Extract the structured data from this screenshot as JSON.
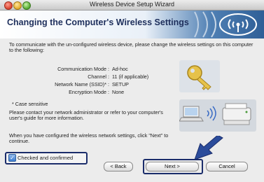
{
  "window": {
    "title": "Wireless Device Setup Wizard"
  },
  "banner": {
    "title": "Changing the Computer's Wireless Settings"
  },
  "intro": "To communicate with the un-configured wireless device, please change the wireless settings on this computer to the following:",
  "settings": [
    {
      "label": "Communication Mode :",
      "value": "Ad-hoc"
    },
    {
      "label": "Channel :",
      "value": "11  (if applicable)"
    },
    {
      "label": "Network Name (SSID)* :",
      "value": "SETUP"
    },
    {
      "label": "Encryption Mode :",
      "value": "None"
    }
  ],
  "case_note": "* Case sensitive",
  "contact_note": "Please contact your network administrator or refer to your computer's user's guide for more information.",
  "instruction": "When you have configured the wireless network settings, click \"Next\" to continue.",
  "checkbox": {
    "label": "Checked and confirmed",
    "checked": true
  },
  "buttons": {
    "back": "< Back",
    "next": "Next >",
    "cancel": "Cancel"
  },
  "colors": {
    "banner_blue": "#2f5f97",
    "highlight": "#1b2d6b",
    "arrow": "#2b4c9b"
  }
}
